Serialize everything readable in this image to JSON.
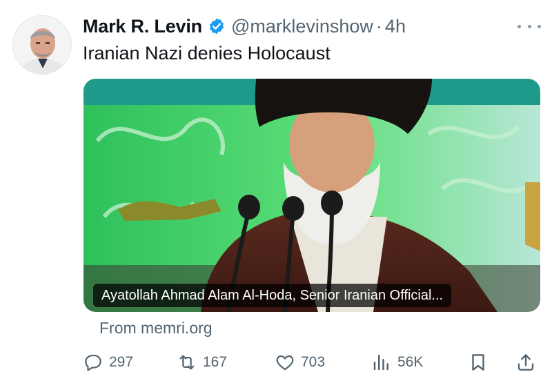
{
  "author": {
    "name": "Mark R. Levin",
    "handle": "@marklevinshow",
    "separator": "·",
    "time": "4h",
    "verified_color": "#1d9bf0"
  },
  "tweet": {
    "text": "Iranian Nazi denies Holocaust"
  },
  "media": {
    "caption": "Ayatollah Ahmad Alam Al-Hoda, Senior Iranian Official...",
    "source": "From memri.org"
  },
  "actions": {
    "replies": "297",
    "reposts": "167",
    "likes": "703",
    "views": "56K"
  },
  "icons": [
    "more-icon",
    "verified-icon",
    "reply-icon",
    "repost-icon",
    "like-icon",
    "views-icon",
    "bookmark-icon",
    "share-icon"
  ],
  "colors": {
    "text": "#0f1419",
    "secondary": "#536471",
    "accent": "#1d9bf0"
  }
}
